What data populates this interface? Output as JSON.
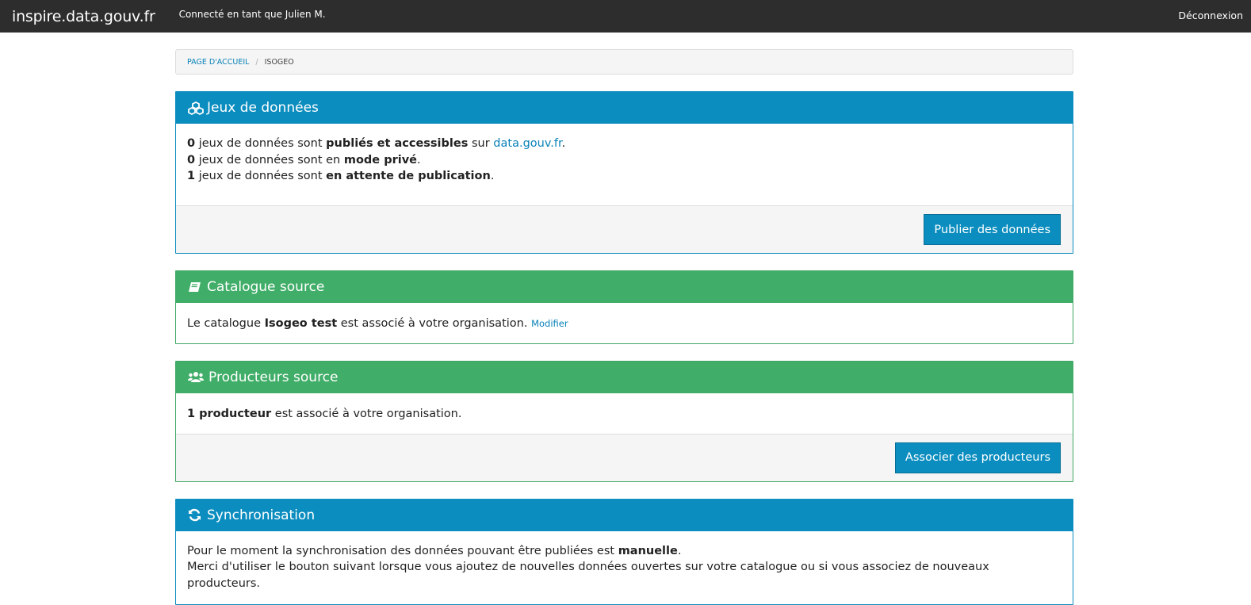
{
  "nav": {
    "brand": "inspire.data.gouv.fr",
    "connected": "Connecté en tant que Julien M.",
    "logout": "Déconnexion"
  },
  "breadcrumb": {
    "home": "PAGE D'ACCUEIL",
    "separator": "/",
    "current": "ISOGEO"
  },
  "datasets": {
    "title": "Jeux de données",
    "icon": "cubes-icon",
    "line1": {
      "count": "0",
      "text": " jeux de données sont ",
      "strong": "publiés et accessibles",
      "mid": " sur ",
      "link": "data.gouv.fr",
      "end": "."
    },
    "line2": {
      "count": "0",
      "text": " jeux de données sont en ",
      "strong": "mode privé",
      "end": "."
    },
    "line3": {
      "count": "1",
      "text": " jeux de données sont ",
      "strong": "en attente de publication",
      "end": "."
    },
    "button": "Publier des données"
  },
  "catalog": {
    "title": "Catalogue source",
    "icon": "book-icon",
    "prefix": "Le catalogue ",
    "name": "Isogeo test",
    "suffix": " est associé à votre organisation. ",
    "edit": "Modifier"
  },
  "producers": {
    "title": "Producteurs source",
    "icon": "users-icon",
    "strong": "1 producteur",
    "suffix": " est associé à votre organisation.",
    "button": "Associer des producteurs"
  },
  "sync": {
    "title": "Synchronisation",
    "icon": "refresh-icon",
    "line1_prefix": "Pour le moment la synchronisation des données pouvant être publiées est ",
    "line1_strong": "manuelle",
    "line1_end": ".",
    "line2": "Merci d'utiliser le bouton suivant lorsque vous ajoutez de nouvelles données ouvertes sur votre catalogue ou si vous associez de nouveaux producteurs."
  },
  "colors": {
    "navbar": "#2d2d2d",
    "primary": "#0b8dbf",
    "success": "#40ad68"
  }
}
